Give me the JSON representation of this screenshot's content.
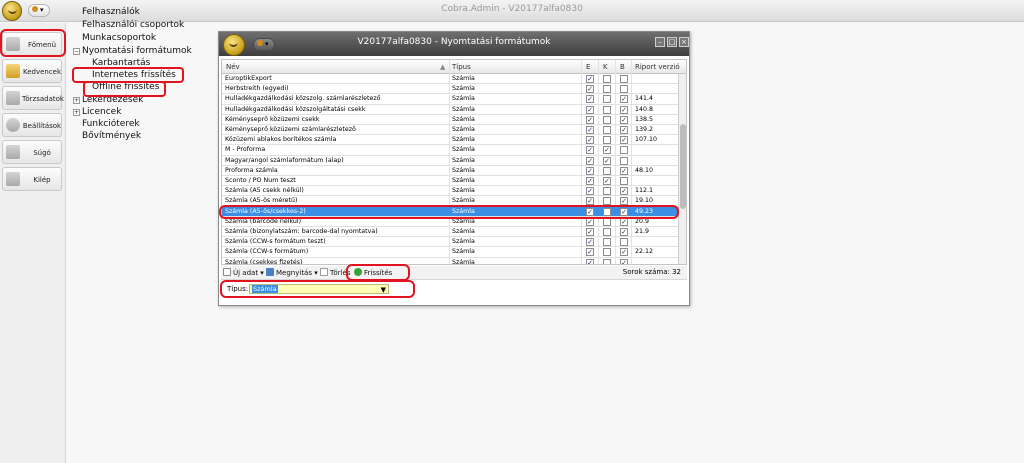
{
  "app": {
    "title": "Cobra.Admin - V20177alfa0830"
  },
  "left_menu": [
    {
      "name": "fomenu",
      "label": "Főmenü",
      "color": "#e08a2b"
    },
    {
      "name": "kedvencek",
      "label": "Kedvencek",
      "color": "#e3b340"
    },
    {
      "name": "torzsadatok",
      "label": "Törzsadatok",
      "color": "#8c8c8c"
    },
    {
      "name": "beallitasok",
      "label": "Beállítások",
      "color": "#8c8c8c"
    },
    {
      "name": "sugo",
      "label": "Súgó",
      "color": "#8c8c8c"
    },
    {
      "name": "kilep",
      "label": "Kilép",
      "color": "#8c8c8c"
    }
  ],
  "tree": [
    {
      "label": "Felhasználók",
      "expander": ""
    },
    {
      "label": "Felhasználói csoportok",
      "expander": ""
    },
    {
      "label": "Munkacsoportok",
      "expander": ""
    },
    {
      "label": "Nyomtatási formátumok",
      "expander": "−"
    },
    {
      "label": "Karbantartás",
      "expander": ""
    },
    {
      "label": "Internetes frissítés",
      "expander": ""
    },
    {
      "label": "Offline frissítés",
      "expander": ""
    },
    {
      "label": "Lekérdezések",
      "expander": "+"
    },
    {
      "label": "Licencek",
      "expander": "+"
    },
    {
      "label": "Funkcióterek",
      "expander": ""
    },
    {
      "label": "Bővítmények",
      "expander": ""
    }
  ],
  "window": {
    "title": "V20177alfa0830 - Nyomtatási formátumok"
  },
  "grid": {
    "columns": {
      "name": "Név",
      "type": "Típus",
      "e": "E",
      "k": "K",
      "b": "B",
      "version": "Riport verzió"
    },
    "rows": [
      {
        "name": "EuroptikExport",
        "type": "Számla",
        "e": true,
        "k": false,
        "b": false,
        "version": ""
      },
      {
        "name": "Herbstreith (egyedi)",
        "type": "Számla",
        "e": true,
        "k": false,
        "b": false,
        "version": ""
      },
      {
        "name": "Hulladékgazdálkodási közszolg. számlarészletező",
        "type": "Számla",
        "e": true,
        "k": false,
        "b": true,
        "version": "141.4"
      },
      {
        "name": "Hulladékgazdálkodási közszolgáltatási csekk",
        "type": "Számla",
        "e": true,
        "k": false,
        "b": true,
        "version": "140.8"
      },
      {
        "name": "Kéményseprő közüzemi csekk",
        "type": "Számla",
        "e": true,
        "k": false,
        "b": true,
        "version": "138.5"
      },
      {
        "name": "Kéményseprő közüzemi számlarészletező",
        "type": "Számla",
        "e": true,
        "k": false,
        "b": true,
        "version": "139.2"
      },
      {
        "name": "Közüzemi ablakos borítékos számla",
        "type": "Számla",
        "e": true,
        "k": false,
        "b": true,
        "version": "107.10"
      },
      {
        "name": "M - Proforma",
        "type": "Számla",
        "e": true,
        "k": true,
        "b": false,
        "version": ""
      },
      {
        "name": "Magyar/angol számlaformátum (alap)",
        "type": "Számla",
        "e": true,
        "k": true,
        "b": false,
        "version": ""
      },
      {
        "name": "Proforma számla",
        "type": "Számla",
        "e": true,
        "k": false,
        "b": true,
        "version": "48.10"
      },
      {
        "name": "Sconto / PO Num teszt",
        "type": "Számla",
        "e": true,
        "k": true,
        "b": false,
        "version": ""
      },
      {
        "name": "Számla (A5 csekk nélkül)",
        "type": "Számla",
        "e": true,
        "k": false,
        "b": true,
        "version": "112.1"
      },
      {
        "name": "Számla (A5-ös méretű)",
        "type": "Számla",
        "e": true,
        "k": false,
        "b": true,
        "version": "19.10"
      },
      {
        "name": "Számla (A5-ös/csekkes-2)",
        "type": "Számla",
        "e": true,
        "k": false,
        "b": true,
        "version": "49.23"
      },
      {
        "name": "Számla (bárcode nélkül)",
        "type": "Számla",
        "e": true,
        "k": false,
        "b": true,
        "version": "20.9"
      },
      {
        "name": "Számla (bizonylatszám: barcode-dal nyomtatva)",
        "type": "Számla",
        "e": true,
        "k": false,
        "b": true,
        "version": "21.9"
      },
      {
        "name": "Számla (CCW-s formátum teszt)",
        "type": "Számla",
        "e": true,
        "k": false,
        "b": false,
        "version": ""
      },
      {
        "name": "Számla (CCW-s formátum)",
        "type": "Számla",
        "e": true,
        "k": false,
        "b": true,
        "version": "22.12"
      },
      {
        "name": "Számla (csekkes fizetés)",
        "type": "Számla",
        "e": true,
        "k": false,
        "b": true,
        "version": ""
      }
    ],
    "selected_index": 13
  },
  "toolbar": {
    "new_label": "Új adat",
    "open_label": "Megnyitás",
    "delete_label": "Törlés",
    "refresh_label": "Frissítés",
    "count_label": "Sorok száma:",
    "count_value": "32"
  },
  "filter": {
    "label": "Típus:",
    "value": "Számla"
  },
  "colors": {
    "selection": "#3a8fe4",
    "highlight_ring": "#e0141e",
    "window_title": "#4a4a4a"
  }
}
